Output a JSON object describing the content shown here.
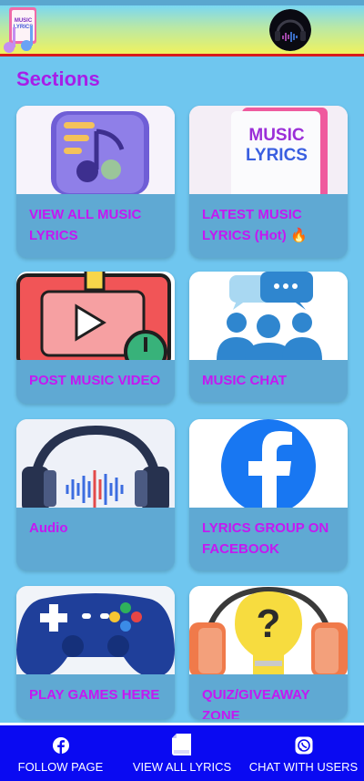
{
  "header": {
    "logo_text_line1": "MUSIC",
    "logo_text_line2": "LYRICS"
  },
  "sections_title": "Sections",
  "cards": [
    {
      "label": "VIEW ALL MUSIC LYRICS",
      "icon": "music-list-icon"
    },
    {
      "label": "LATEST MUSIC LYRICS (Hot) 🔥",
      "icon": "music-lyrics-book-icon",
      "thumb_text_line1": "MUSIC",
      "thumb_text_line2": "LYRICS"
    },
    {
      "label": "POST MUSIC VIDEO",
      "icon": "video-play-icon"
    },
    {
      "label": "MUSIC CHAT",
      "icon": "group-chat-icon"
    },
    {
      "label": "Audio",
      "icon": "headphones-icon"
    },
    {
      "label": "LYRICS GROUP ON FACEBOOK",
      "icon": "facebook-icon"
    },
    {
      "label": "PLAY GAMES HERE",
      "icon": "gamepad-icon"
    },
    {
      "label": "QUIZ/GIVEAWAY ZONE",
      "icon": "quiz-headphones-icon"
    }
  ],
  "bottom_nav": [
    {
      "label": "FOLLOW PAGE",
      "icon": "facebook-icon"
    },
    {
      "label": "VIEW ALL LYRICS",
      "icon": "book-icon"
    },
    {
      "label": "CHAT WITH USERS",
      "icon": "whatsapp-icon"
    }
  ],
  "colors": {
    "background": "#6fc6ef",
    "accent_purple": "#a71ee8",
    "card_label": "#c418f2",
    "nav_bar": "#0a0af2",
    "header_border": "#d81b1b"
  }
}
